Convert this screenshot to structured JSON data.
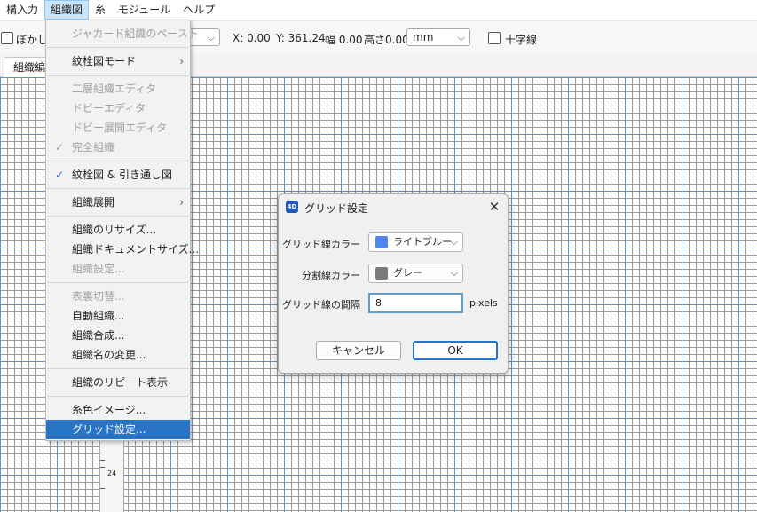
{
  "menubar": {
    "items": [
      "構入力",
      "組織図",
      "糸",
      "モジュール",
      "ヘルプ"
    ]
  },
  "toolbar": {
    "blur_label": "ぼかし",
    "x_label": "X: 0.00",
    "y_label": "Y: 361.24",
    "width_label": "幅 0.00",
    "height_label": "高さ0.00",
    "unit_value": "mm",
    "crosshair_label": "十字線"
  },
  "tabs": {
    "active_label": "組織編"
  },
  "ruler": {
    "label": "24"
  },
  "menu": {
    "items": [
      {
        "label": "ジャカード組織のペースト",
        "disabled": true
      },
      {
        "label": "紋栓図モード",
        "arrow": "›"
      },
      {
        "label": "二層組織エディタ",
        "disabled": true
      },
      {
        "label": "ドビーエディタ",
        "disabled": true
      },
      {
        "label": "ドビー展開エディタ",
        "disabled": true
      },
      {
        "label": "完全組織",
        "disabled": true,
        "check": "✓"
      },
      {
        "label": "紋栓図 & 引き通し図",
        "check": "✓"
      },
      {
        "label": "組織展開",
        "arrow": "›"
      },
      {
        "label": "組織のリサイズ..."
      },
      {
        "label": "組織ドキュメントサイズ..."
      },
      {
        "label": "組織設定...",
        "disabled": true
      },
      {
        "label": "表裏切替...",
        "disabled": true
      },
      {
        "label": "自動組織..."
      },
      {
        "label": "組織合成..."
      },
      {
        "label": "組織名の変更..."
      },
      {
        "label": "組織のリピート表示"
      },
      {
        "label": "糸色イメージ..."
      },
      {
        "label": "グリッド設定..."
      }
    ]
  },
  "dialog": {
    "app_icon": "4D",
    "title": "グリッド設定",
    "close_glyph": "✕",
    "grid_color_label": "グリッド線カラー",
    "grid_color_value": "ライトブルー",
    "grid_color_hex": "#4f86f0",
    "divider_color_label": "分割線カラー",
    "divider_color_value": "グレー",
    "divider_color_hex": "#7a7a7a",
    "spacing_label": "グリッド線の間隔",
    "spacing_value": "8",
    "spacing_unit": "pixels",
    "cancel_label": "キャンセル",
    "ok_label": "OK"
  }
}
